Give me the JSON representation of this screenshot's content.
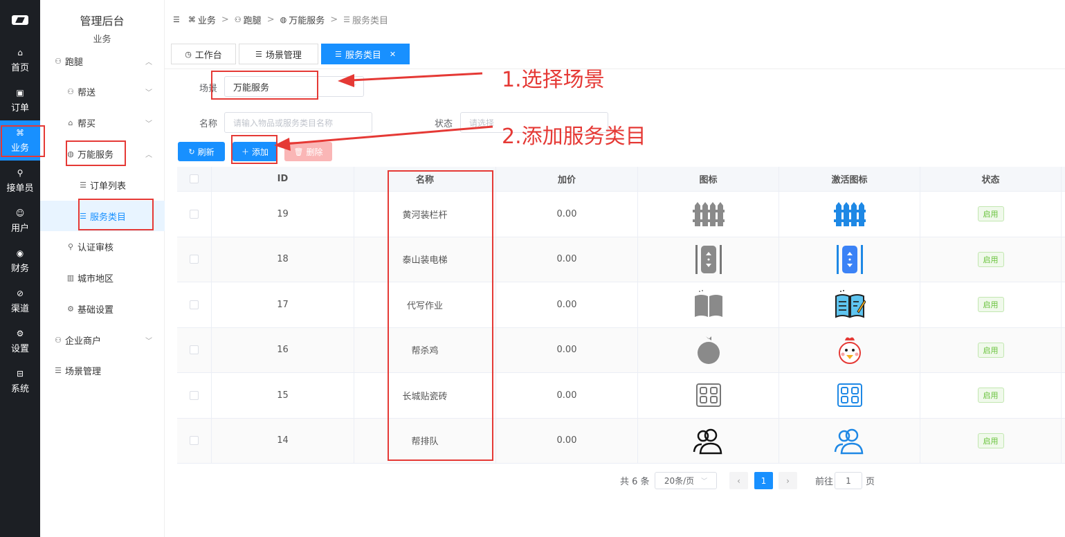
{
  "rail": {
    "items": [
      {
        "label": "首页",
        "icon": "home-icon"
      },
      {
        "label": "订单",
        "icon": "order-icon"
      },
      {
        "label": "业务",
        "icon": "business-icon"
      },
      {
        "label": "接单员",
        "icon": "rider-icon"
      },
      {
        "label": "用户",
        "icon": "user-icon"
      },
      {
        "label": "财务",
        "icon": "finance-icon"
      },
      {
        "label": "渠道",
        "icon": "channel-icon"
      },
      {
        "label": "设置",
        "icon": "settings-icon"
      },
      {
        "label": "系统",
        "icon": "system-icon"
      }
    ]
  },
  "sidebar": {
    "title": "管理后台",
    "subtitle": "业务",
    "items": [
      {
        "label": "跑腿"
      },
      {
        "label": "帮送"
      },
      {
        "label": "帮买"
      },
      {
        "label": "万能服务"
      },
      {
        "label": "订单列表"
      },
      {
        "label": "服务类目"
      },
      {
        "label": "认证审核"
      },
      {
        "label": "城市地区"
      },
      {
        "label": "基础设置"
      },
      {
        "label": "企业商户"
      },
      {
        "label": "场景管理"
      }
    ]
  },
  "breadcrumb": [
    "业务",
    "跑腿",
    "万能服务",
    "服务类目"
  ],
  "tabs": [
    {
      "label": "工作台"
    },
    {
      "label": "场景管理"
    },
    {
      "label": "服务类目"
    }
  ],
  "filters": {
    "scene_label": "场景",
    "scene_value": "万能服务",
    "name_label": "名称",
    "name_placeholder": "请输入物品或服务类目名称",
    "status_label": "状态",
    "status_placeholder": "请选择"
  },
  "toolbar": {
    "refresh": "刷新",
    "add": "添加",
    "delete": "删除",
    "colors": {
      "primary": "#1890ff",
      "danger_disabled": "#fab6b6"
    }
  },
  "table": {
    "headers": [
      "ID",
      "名称",
      "加价",
      "图标",
      "激活图标",
      "状态"
    ],
    "rows": [
      {
        "id": "19",
        "name": "黄河装栏杆",
        "price": "0.00",
        "icon": "fence-icon",
        "status": "启用"
      },
      {
        "id": "18",
        "name": "泰山装电梯",
        "price": "0.00",
        "icon": "elevator-icon",
        "status": "启用"
      },
      {
        "id": "17",
        "name": "代写作业",
        "price": "0.00",
        "icon": "homework-book-icon",
        "status": "启用"
      },
      {
        "id": "16",
        "name": "帮杀鸡",
        "price": "0.00",
        "icon": "chicken-icon",
        "status": "启用"
      },
      {
        "id": "15",
        "name": "长城贴瓷砖",
        "price": "0.00",
        "icon": "tiles-icon",
        "status": "启用"
      },
      {
        "id": "14",
        "name": "帮排队",
        "price": "0.00",
        "icon": "queue-people-icon",
        "status": "启用"
      }
    ]
  },
  "pagination": {
    "total": "共 6 条",
    "page_size": "20条/页",
    "current": "1",
    "goto_label": "前往",
    "goto_value": "1",
    "page_unit": "页"
  },
  "annotations": {
    "step1": "1.选择场景",
    "step2": "2.添加服务类目",
    "color": "#e53935"
  }
}
